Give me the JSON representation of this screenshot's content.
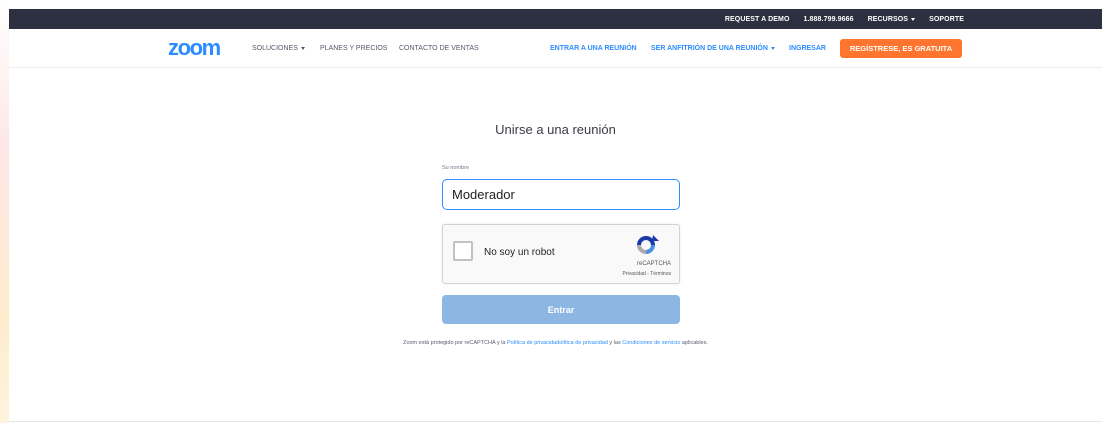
{
  "topbar": {
    "request_demo": "REQUEST A DEMO",
    "phone": "1.888.799.9666",
    "resources": "RECURSOS",
    "support": "SOPORTE"
  },
  "nav": {
    "logo": "zoom",
    "solutions": "SOLUCIONES",
    "plans": "PLANES Y PRECIOS",
    "contact": "CONTACTO DE VENTAS",
    "join": "ENTRAR A UNA REUNIÓN",
    "host": "SER ANFITRIÓN DE UNA REUNIÓN",
    "signin": "INGRESAR",
    "signup": "REGÍSTRESE, ES GRATUITA"
  },
  "main": {
    "title": "Unirse a una reunión",
    "name_label": "Su nombre",
    "name_value": "Moderador",
    "captcha_label": "No soy un robot",
    "captcha_brand": "reCAPTCHA",
    "captcha_terms": "Privacidad - Términos",
    "enter_button": "Entrar"
  },
  "legal": {
    "prefix": "Zoom está protegido por reCAPTCHA y la ",
    "privacy": "Política de privacidadolítica de privacidad",
    "middle": " y las ",
    "terms": "Condiciones de servicio",
    "suffix": " aplicables."
  },
  "colors": {
    "brand_blue": "#2d8cff",
    "topbar_bg": "#2d3041",
    "signup_orange": "#ff742e",
    "enter_disabled": "#8cb7e3"
  }
}
